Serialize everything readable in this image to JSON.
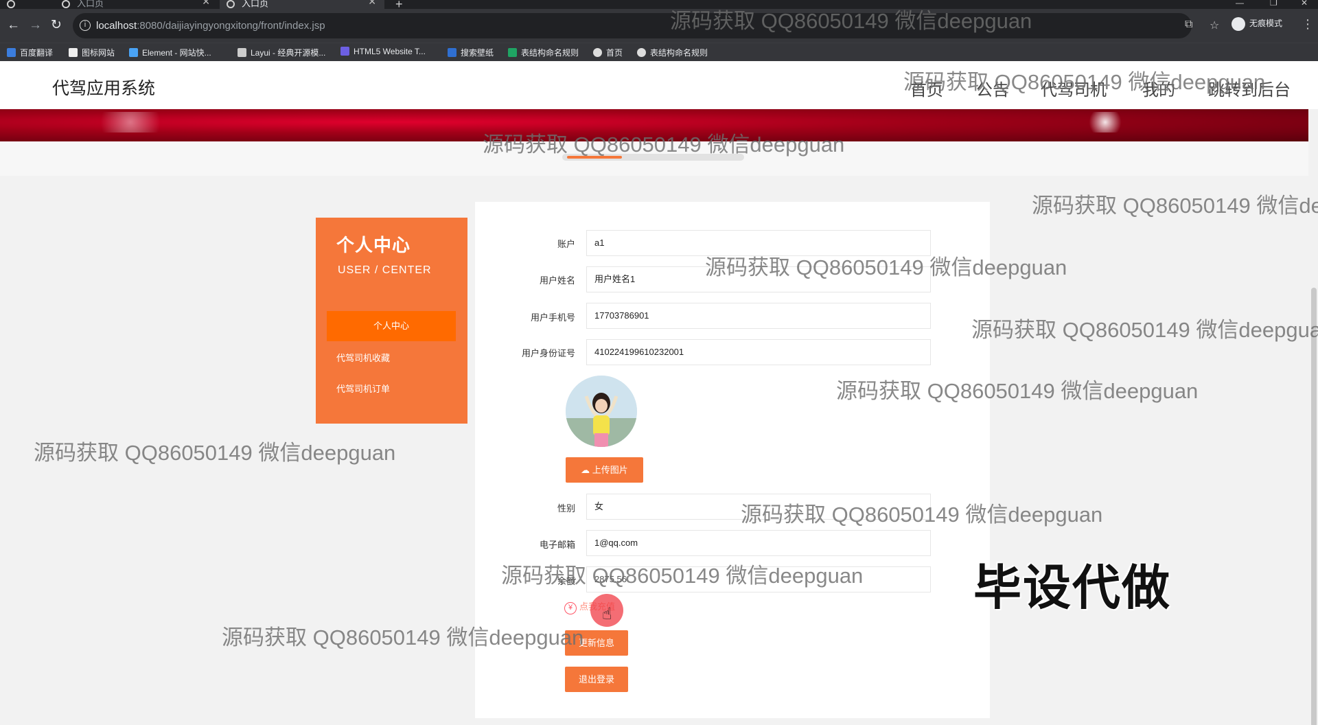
{
  "browser": {
    "tabs": [
      {
        "title": "入口页"
      },
      {
        "title": "入口页"
      }
    ],
    "url_host": "localhost",
    "url_path": ":8080/daijiayingyongxitong/front/index.jsp",
    "profile_label": "无痕模式",
    "bookmarks": [
      {
        "label": "百度翻译",
        "color": "#3b7ddd"
      },
      {
        "label": "图标网站",
        "color": "#eeeeee"
      },
      {
        "label": "Element - 网站快...",
        "color": "#4aa3f5"
      },
      {
        "label": "Layui - 经典开源模...",
        "color": "#cccccc"
      },
      {
        "label": "HTML5 Website T...",
        "color": "#6c5fe3"
      },
      {
        "label": "搜索壁纸",
        "color": "#2f6fd1"
      },
      {
        "label": "表结构命名规则",
        "color": "#1fa463"
      },
      {
        "label": "首页",
        "color": "#dddddd"
      },
      {
        "label": "表结构命名规则",
        "color": "#dddddd"
      }
    ]
  },
  "site": {
    "title": "代驾应用系统",
    "nav": [
      "首页",
      "公告",
      "代驾司机",
      "我的",
      "跳转到后台"
    ]
  },
  "sidebar": {
    "title": "个人中心",
    "subtitle": "USER / CENTER",
    "items": [
      {
        "label": "个人中心",
        "active": true
      },
      {
        "label": "代驾司机收藏",
        "active": false
      },
      {
        "label": "代驾司机订单",
        "active": false
      }
    ]
  },
  "form": {
    "account_label": "账户",
    "account_value": "a1",
    "name_label": "用户姓名",
    "name_value": "用户姓名1",
    "phone_label": "用户手机号",
    "phone_value": "17703786901",
    "idcard_label": "用户身份证号",
    "idcard_value": "410224199610232001",
    "upload_label": "上传图片",
    "gender_label": "性别",
    "gender_value": "女",
    "email_label": "电子邮箱",
    "email_value": "1@qq.com",
    "balance_label": "余额",
    "balance_value": "2875.56",
    "recharge_label": "点我充值",
    "update_label": "更新信息",
    "logout_label": "退出登录"
  },
  "watermark_text": "源码获取 QQ86050149 微信deepguan",
  "watermark_cut": "源码获取 QQ86050149 微信de",
  "watermark_cut2": "源码获取 QQ86050149 微信deepgua",
  "stamp_text": "毕设代做",
  "colors": {
    "accent": "#f5773a",
    "accent_active": "#ff6a00",
    "banner": "#c8001f"
  }
}
